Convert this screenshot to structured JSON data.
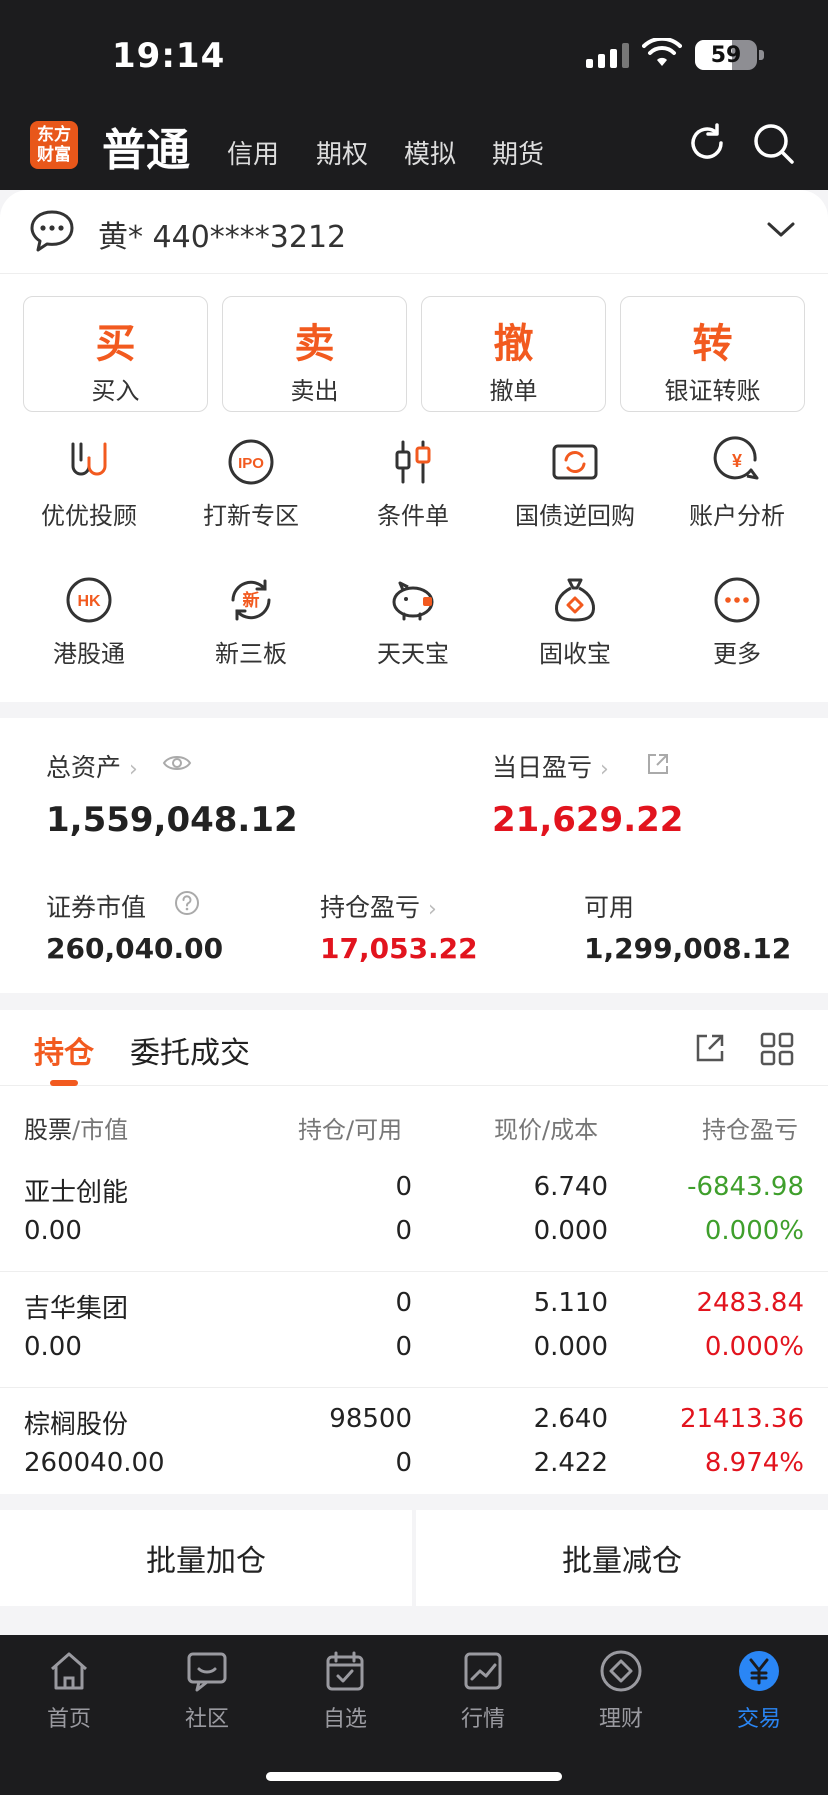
{
  "status_bar": {
    "time": "19:14",
    "battery": "59",
    "battery_level": 0.59
  },
  "header": {
    "logo_text": "东方财富",
    "active_tab": "普通",
    "tabs": [
      "信用",
      "期权",
      "模拟",
      "期货"
    ],
    "icons": [
      "refresh-icon",
      "search-icon"
    ]
  },
  "account": {
    "text": "黄* 440****3212"
  },
  "trade_buttons": [
    {
      "big": "买",
      "label": "买入"
    },
    {
      "big": "卖",
      "label": "卖出"
    },
    {
      "big": "撤",
      "label": "撤单"
    },
    {
      "big": "转",
      "label": "银证转账"
    }
  ],
  "functions": [
    {
      "label": "优优投顾",
      "icon": "advisor-icon"
    },
    {
      "label": "打新专区",
      "icon": "ipo-icon",
      "icon_text": "IPO"
    },
    {
      "label": "条件单",
      "icon": "candlestick-icon"
    },
    {
      "label": "国债逆回购",
      "icon": "repo-icon"
    },
    {
      "label": "账户分析",
      "icon": "analysis-icon",
      "icon_text": "¥"
    },
    {
      "label": "港股通",
      "icon": "hk-icon",
      "icon_text": "HK"
    },
    {
      "label": "新三板",
      "icon": "neeq-icon",
      "icon_text": "新"
    },
    {
      "label": "天天宝",
      "icon": "piggy-icon"
    },
    {
      "label": "固收宝",
      "icon": "moneybag-icon"
    },
    {
      "label": "更多",
      "icon": "more-icon"
    }
  ],
  "assets": {
    "total_label": "总资产",
    "total_value": "1,559,048.12",
    "daily_pl_label": "当日盈亏",
    "daily_pl_value": "21,629.22",
    "market_value_label": "证券市值",
    "market_value": "260,040.00",
    "position_pl_label": "持仓盈亏",
    "position_pl_value": "17,053.22",
    "available_label": "可用",
    "available_value": "1,299,008.12"
  },
  "holdings": {
    "tabs": [
      "持仓",
      "委托成交"
    ],
    "headers": {
      "c1a": "股票",
      "c1b": "市值",
      "c2a": "持仓",
      "c2b": "可用",
      "c3a": "现价",
      "c3b": "成本",
      "c4": "持仓盈亏"
    },
    "rows": [
      {
        "name": "亚士创能",
        "market_value": "0.00",
        "position": "0",
        "available": "0",
        "price": "6.740",
        "cost": "0.000",
        "pl": "-6843.98",
        "pl_pct": "0.000%",
        "color": "#3f9f2c"
      },
      {
        "name": "吉华集团",
        "market_value": "0.00",
        "position": "0",
        "available": "0",
        "price": "5.110",
        "cost": "0.000",
        "pl": "2483.84",
        "pl_pct": "0.000%",
        "color": "#e2141e"
      },
      {
        "name": "棕榈股份",
        "market_value": "260040.00",
        "position": "98500",
        "available": "0",
        "price": "2.640",
        "cost": "2.422",
        "pl": "21413.36",
        "pl_pct": "8.974%",
        "color": "#e2141e"
      }
    ]
  },
  "batch": {
    "add": "批量加仓",
    "reduce": "批量减仓"
  },
  "bottom_nav": [
    {
      "label": "首页",
      "icon": "home-icon"
    },
    {
      "label": "社区",
      "icon": "community-icon"
    },
    {
      "label": "自选",
      "icon": "watchlist-icon"
    },
    {
      "label": "行情",
      "icon": "market-icon"
    },
    {
      "label": "理财",
      "icon": "wealth-icon"
    },
    {
      "label": "交易",
      "icon": "trade-icon",
      "active": true
    }
  ],
  "colors": {
    "accent": "#f25a1f",
    "red": "#e2141e",
    "green": "#3f9f2c",
    "nav_active": "#2a86f5"
  }
}
